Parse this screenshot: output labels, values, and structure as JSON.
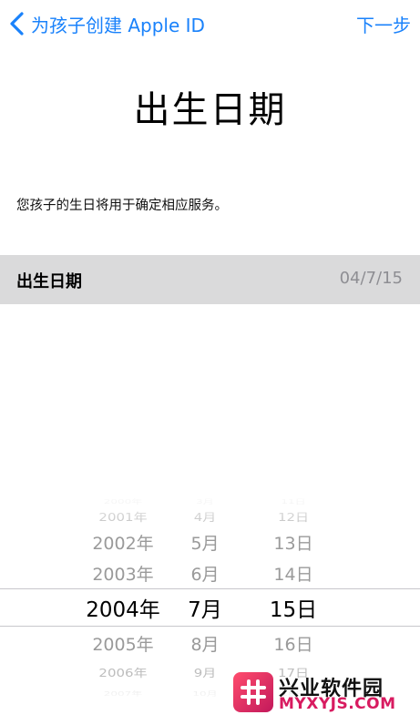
{
  "nav": {
    "back_label": "为孩子创建 Apple ID",
    "next_label": "下一步",
    "accent": "#1a82fb"
  },
  "title": "出生日期",
  "description": "您孩子的生日将用于确定相应服务。",
  "date_row": {
    "label": "出生日期",
    "value": "04/7/15"
  },
  "picker": {
    "years": [
      "2000年",
      "2001年",
      "2002年",
      "2003年",
      "2004年",
      "2005年",
      "2006年",
      "2007年"
    ],
    "months": [
      "3月",
      "4月",
      "5月",
      "6月",
      "7月",
      "8月",
      "9月",
      "10月"
    ],
    "days": [
      "11日",
      "12日",
      "13日",
      "14日",
      "15日",
      "16日",
      "17日",
      "18日"
    ],
    "selected_index": 4
  },
  "watermark": {
    "name": "兴业软件园",
    "url": "MYXYJS.COM"
  }
}
